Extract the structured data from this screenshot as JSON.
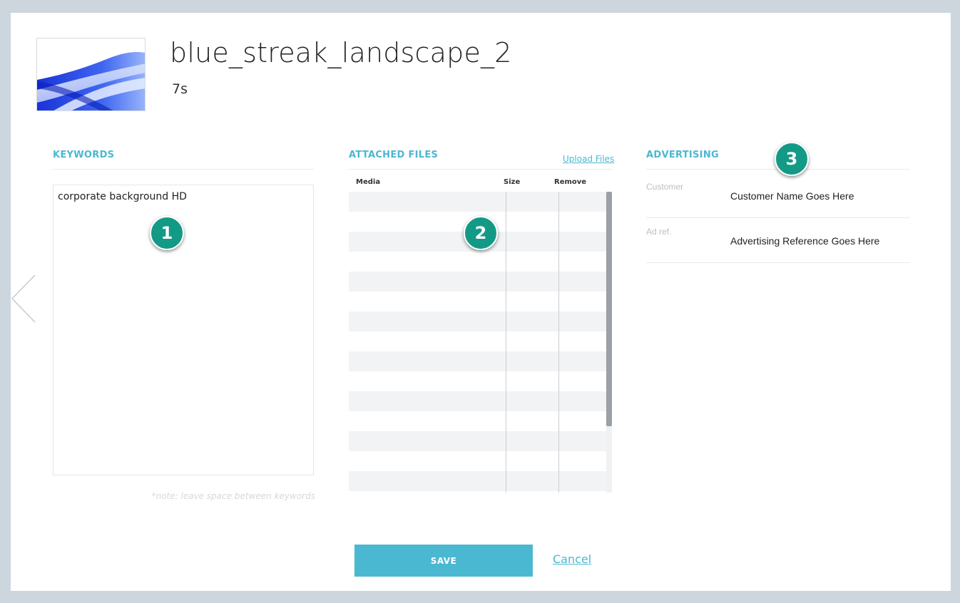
{
  "header": {
    "title": "blue_streak_landscape_2",
    "duration": "7s",
    "thumbnail_icon": "video-thumbnail-blue-streak"
  },
  "keywords": {
    "heading": "KEYWORDS",
    "value": "corporate background HD",
    "note": "*note: leave space between keywords"
  },
  "attached_files": {
    "heading": "ATTACHED FILES",
    "upload_label": "Upload Files",
    "columns": [
      "Media",
      "Size",
      "Remove"
    ],
    "rows": []
  },
  "advertising": {
    "heading": "ADVERTISING",
    "fields": [
      {
        "label": "Customer",
        "value": "Customer Name Goes Here"
      },
      {
        "label": "Ad ref.",
        "value": "Advertising Reference Goes Here"
      }
    ]
  },
  "badges": [
    "1",
    "2",
    "3"
  ],
  "actions": {
    "save_label": "SAVE",
    "cancel_label": "Cancel"
  },
  "nav": {
    "prev_icon": "chevron-left-icon"
  },
  "colors": {
    "accent": "#4bb8d2",
    "badge": "#139a86",
    "background": "#cdd5dd"
  }
}
